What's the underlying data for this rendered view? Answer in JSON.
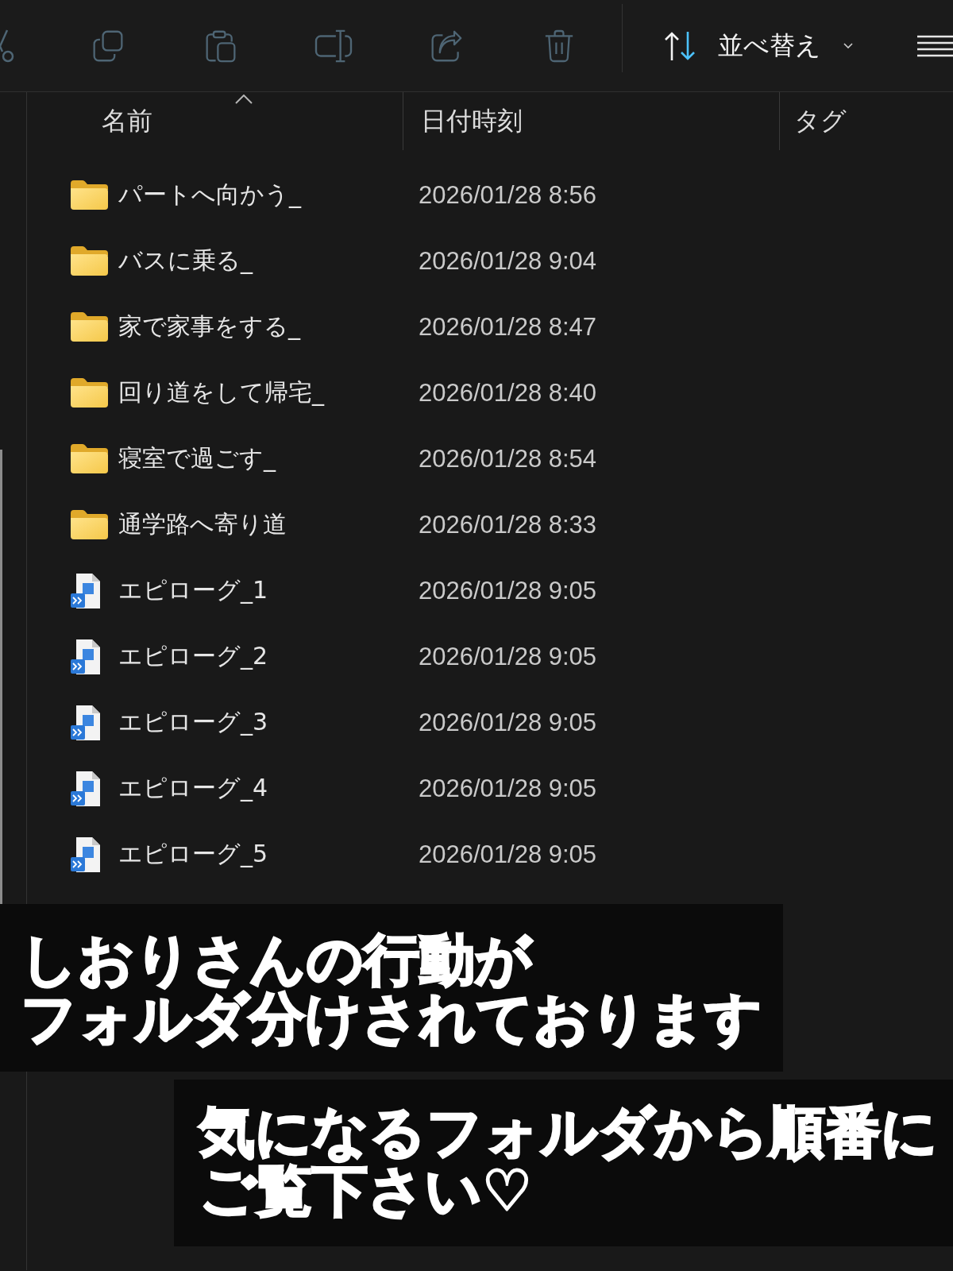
{
  "toolbar": {
    "buttons": [
      {
        "kind": "cut",
        "disabled": true
      },
      {
        "kind": "copy",
        "disabled": true
      },
      {
        "kind": "paste",
        "disabled": true
      },
      {
        "kind": "rename",
        "disabled": true
      },
      {
        "kind": "share",
        "disabled": true
      },
      {
        "kind": "delete",
        "disabled": true
      }
    ],
    "sort_button": {
      "label": "並べ替え"
    }
  },
  "columns": [
    {
      "label": "名前",
      "sorted": true
    },
    {
      "label": "日付時刻",
      "sorted": false
    },
    {
      "label": "タグ",
      "sorted": false
    }
  ],
  "rows": [
    {
      "kind": "folder",
      "name": "パートへ向かう_",
      "date": "2026/01/28 8:56"
    },
    {
      "kind": "folder",
      "name": "バスに乗る_",
      "date": "2026/01/28 9:04"
    },
    {
      "kind": "folder",
      "name": "家で家事をする_",
      "date": "2026/01/28 8:47"
    },
    {
      "kind": "folder",
      "name": "回り道をして帰宅_",
      "date": "2026/01/28 8:40"
    },
    {
      "kind": "folder",
      "name": "寝室で過ごす_",
      "date": "2026/01/28 8:54"
    },
    {
      "kind": "folder",
      "name": "通学路へ寄り道",
      "date": "2026/01/28 8:33"
    },
    {
      "kind": "file",
      "name": "エピローグ_1",
      "date": "2026/01/28 9:05"
    },
    {
      "kind": "file",
      "name": "エピローグ_2",
      "date": "2026/01/28 9:05"
    },
    {
      "kind": "file",
      "name": "エピローグ_3",
      "date": "2026/01/28 9:05"
    },
    {
      "kind": "file",
      "name": "エピローグ_4",
      "date": "2026/01/28 9:05"
    },
    {
      "kind": "file",
      "name": "エピローグ_5",
      "date": "2026/01/28 9:05"
    }
  ],
  "captions": [
    {
      "lines": [
        "しおりさんの行動が",
        "フォルダ分けされております"
      ]
    },
    {
      "lines": [
        "気になるフォルダから順番に",
        "ご覧下さい♡"
      ]
    }
  ]
}
